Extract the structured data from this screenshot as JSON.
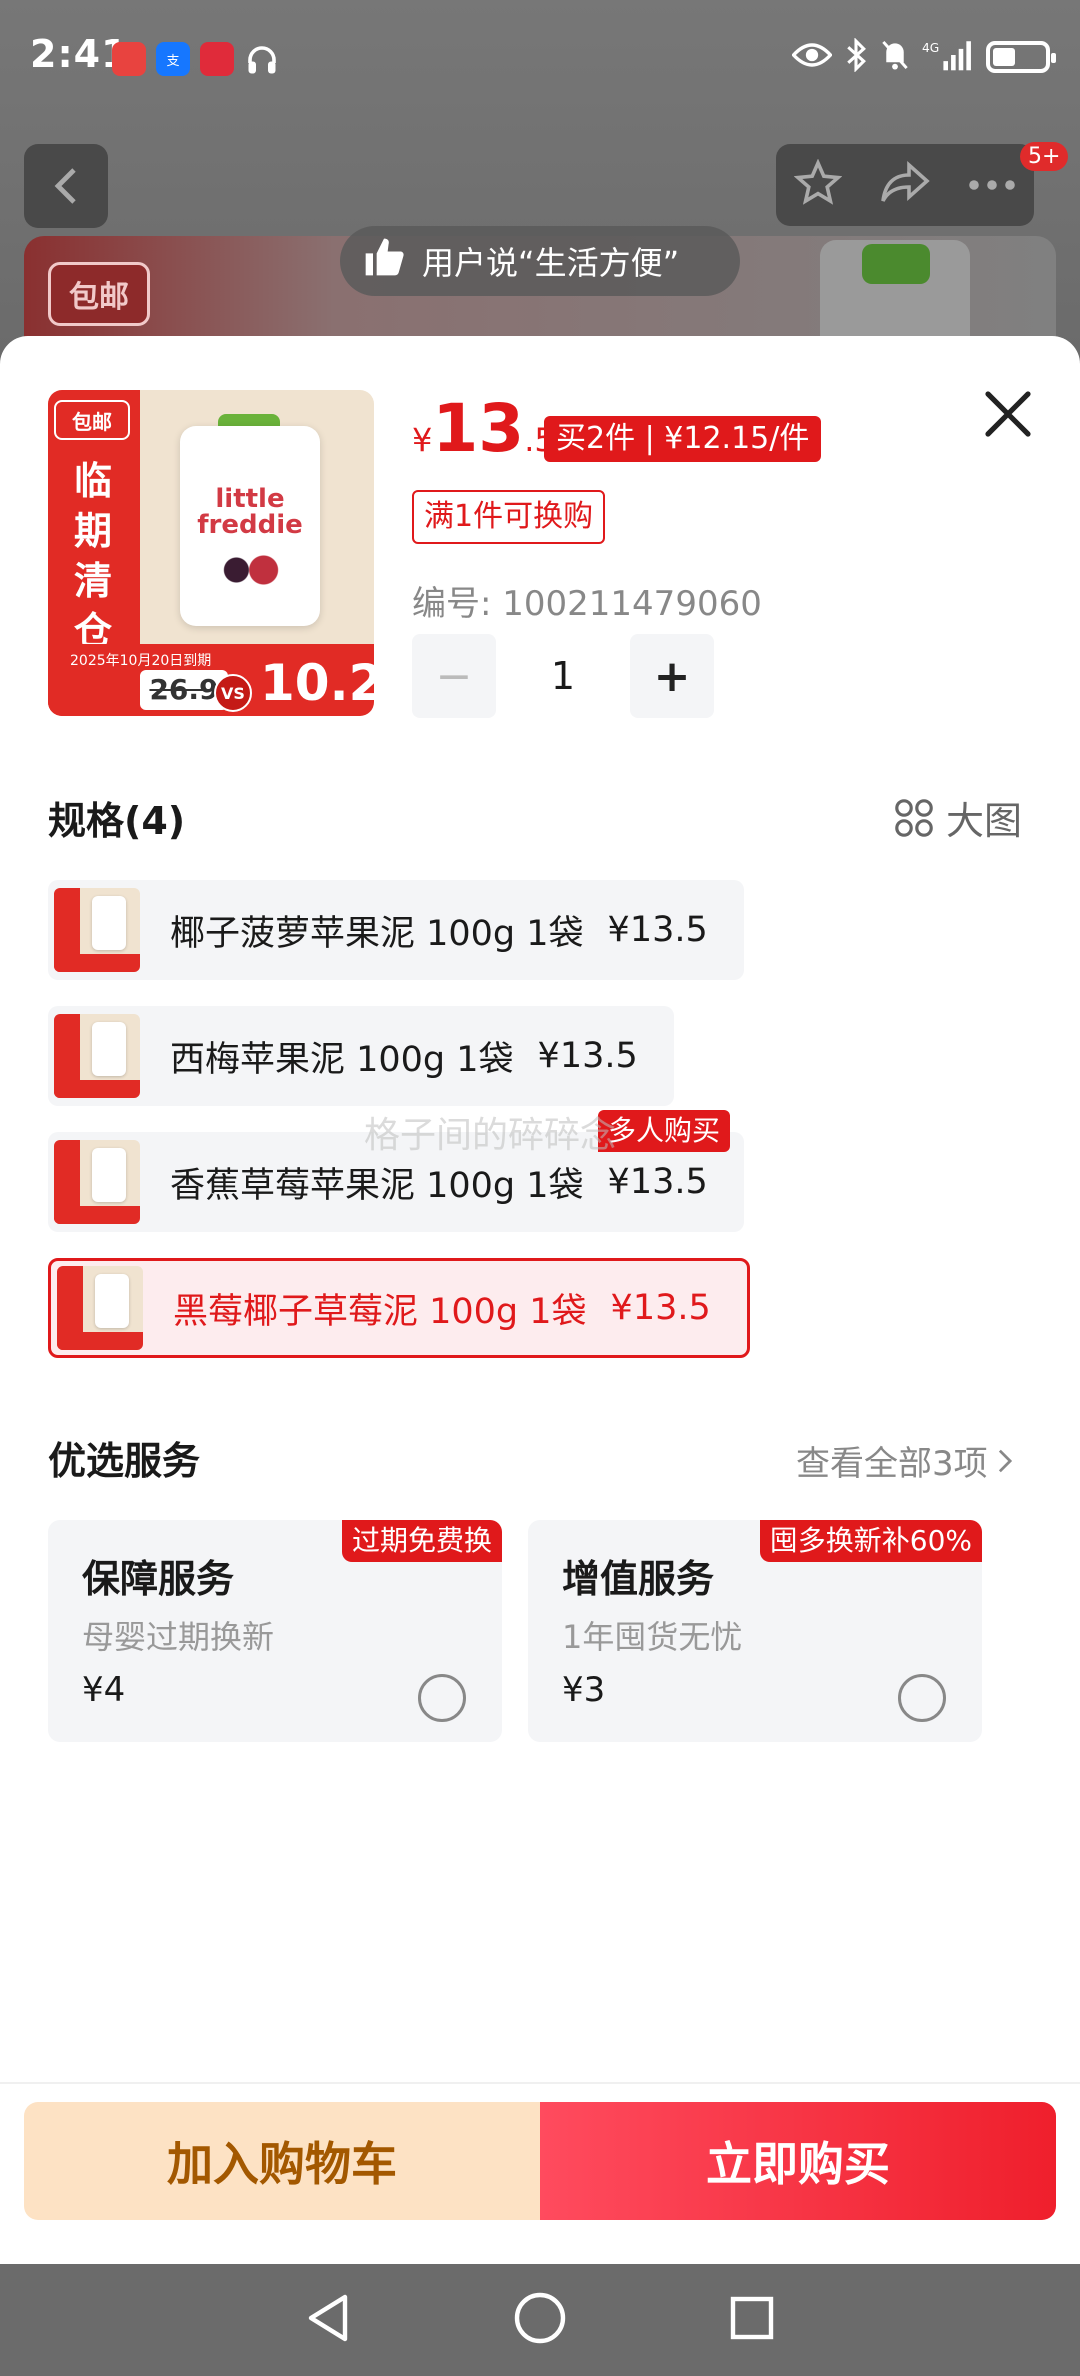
{
  "status_bar": {
    "time": "2:41",
    "apps": [
      {
        "name": "app-icon-1",
        "label": "",
        "color": "#e8433f"
      },
      {
        "name": "alipay-icon",
        "label": "支",
        "color": "#1677ff"
      },
      {
        "name": "app-icon-3",
        "label": "",
        "color": "#e02b3a"
      }
    ],
    "badge_count": "5+"
  },
  "background": {
    "hero_tag": "包邮",
    "toast": "用户说“生活方便”"
  },
  "product": {
    "thumb": {
      "free_ship": "包邮",
      "clearance": "临期清仓",
      "date": "2025年10月20日到期",
      "was_price": "26.9",
      "vs": "VS",
      "now_price": "10.2",
      "brand": "little freddie"
    },
    "price": {
      "currency": "¥",
      "integer": "13",
      "decimal": ".5"
    },
    "promo": "买2件 | ¥12.15/件",
    "exchange": "满1件可换购",
    "sku_code": "编号: 100211479060",
    "quantity": "1",
    "minus": "−",
    "plus": "+"
  },
  "spec": {
    "title": "规格(4)",
    "big_image": "大图",
    "items": [
      {
        "name": "椰子菠萝苹果泥 100g 1袋",
        "price": "¥13.5"
      },
      {
        "name": "西梅苹果泥 100g 1袋",
        "price": "¥13.5"
      },
      {
        "name": "香蕉草莓苹果泥 100g 1袋",
        "price": "¥13.5"
      },
      {
        "name": "黑莓椰子草莓泥 100g 1袋",
        "price": "¥13.5"
      }
    ],
    "hot_badge": "多人购买",
    "watermark": "格子间的碎碎念"
  },
  "services": {
    "title": "优选服务",
    "see_all": "查看全部3项",
    "cards": [
      {
        "title": "保障服务",
        "subtitle": "母婴过期换新",
        "price": "¥4",
        "badge": "过期免费换"
      },
      {
        "title": "增值服务",
        "subtitle": "1年囤货无忧",
        "price": "¥3",
        "badge": "囤多换新补60%"
      }
    ]
  },
  "actions": {
    "cart": "加入购物车",
    "buy": "立即购买"
  },
  "colors": {
    "accent": "#e0191b",
    "cart_bg": "#fde2c4",
    "cart_text": "#a35800"
  }
}
